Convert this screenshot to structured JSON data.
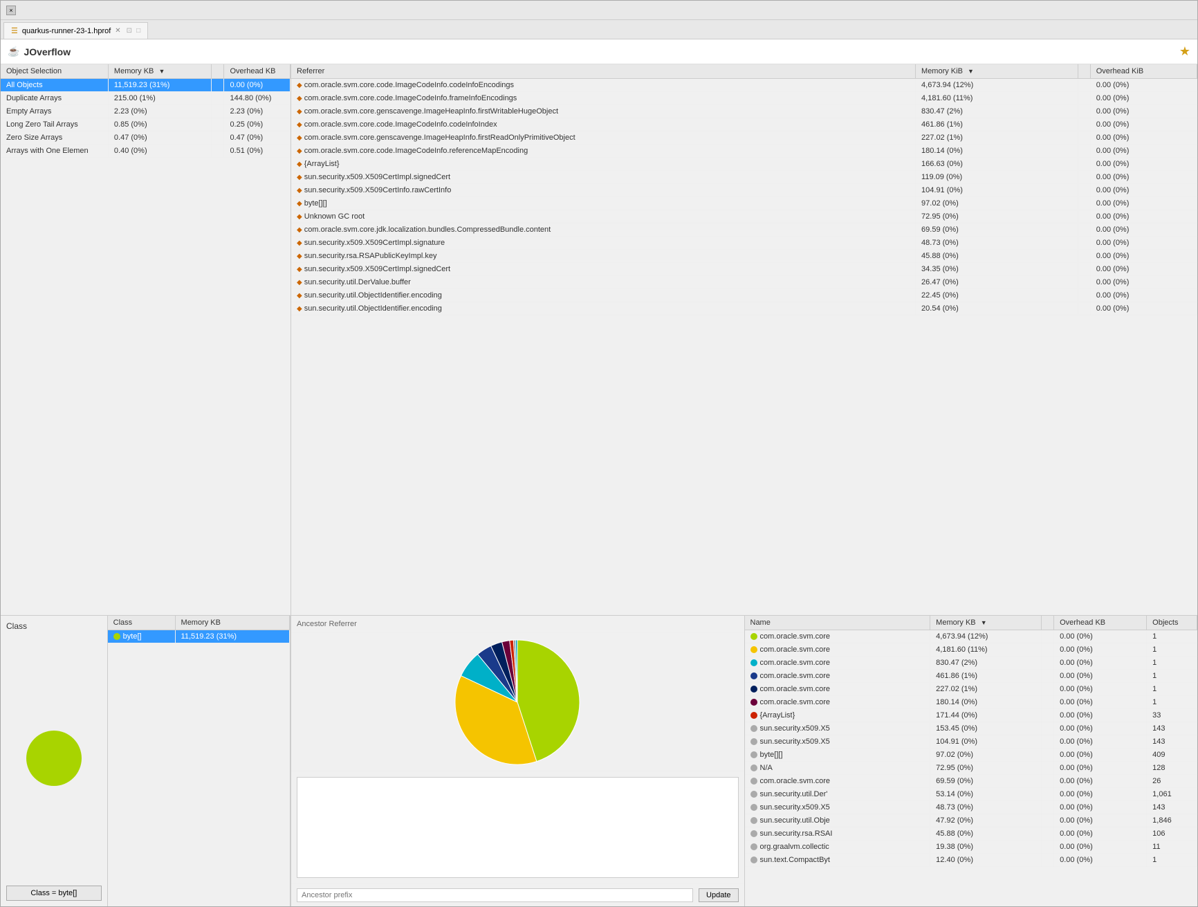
{
  "window": {
    "title": "quarkus-runner-23-1.hprof",
    "close_label": "×",
    "tab_label": "quarkus-runner-23-1.hprof",
    "app_title": "JOverflow",
    "gold_icon": "★"
  },
  "left_top": {
    "columns": [
      "Object Selection",
      "Memory KB",
      "",
      "Overhead KB"
    ],
    "sort_col": "Memory KB",
    "rows": [
      {
        "name": "All Objects",
        "memory": "11,519.23 (31%)",
        "overhead": "0.00 (0%)",
        "selected": true
      },
      {
        "name": "Duplicate Arrays",
        "memory": "215.00 (1%)",
        "overhead": "144.80 (0%)",
        "selected": false
      },
      {
        "name": "Empty Arrays",
        "memory": "2.23 (0%)",
        "overhead": "2.23 (0%)",
        "selected": false
      },
      {
        "name": "Long Zero Tail Arrays",
        "memory": "0.85 (0%)",
        "overhead": "0.25 (0%)",
        "selected": false
      },
      {
        "name": "Zero Size Arrays",
        "memory": "0.47 (0%)",
        "overhead": "0.47 (0%)",
        "selected": false
      },
      {
        "name": "Arrays with One Elemen",
        "memory": "0.40 (0%)",
        "overhead": "0.51 (0%)",
        "selected": false
      }
    ]
  },
  "right_top": {
    "columns": [
      "Referrer",
      "Memory KiB",
      "",
      "Overhead KiB"
    ],
    "rows": [
      {
        "name": "com.oracle.svm.core.code.ImageCodeInfo.codeInfoEncodings",
        "memory": "4,673.94 (12%)",
        "overhead": "0.00 (0%)"
      },
      {
        "name": "com.oracle.svm.core.code.ImageCodeInfo.frameInfoEncodings",
        "memory": "4,181.60 (11%)",
        "overhead": "0.00 (0%)"
      },
      {
        "name": "com.oracle.svm.core.genscavenge.ImageHeapInfo.firstWritableHugeObject",
        "memory": "830.47 (2%)",
        "overhead": "0.00 (0%)"
      },
      {
        "name": "com.oracle.svm.core.code.ImageCodeInfo.codeInfoIndex",
        "memory": "461.86 (1%)",
        "overhead": "0.00 (0%)"
      },
      {
        "name": "com.oracle.svm.core.genscavenge.ImageHeapInfo.firstReadOnlyPrimitiveObject",
        "memory": "227.02 (1%)",
        "overhead": "0.00 (0%)"
      },
      {
        "name": "com.oracle.svm.core.code.ImageCodeInfo.referenceMapEncoding",
        "memory": "180.14 (0%)",
        "overhead": "0.00 (0%)"
      },
      {
        "name": "{ArrayList}",
        "memory": "166.63 (0%)",
        "overhead": "0.00 (0%)"
      },
      {
        "name": "sun.security.x509.X509CertImpl.signedCert",
        "memory": "119.09 (0%)",
        "overhead": "0.00 (0%)"
      },
      {
        "name": "sun.security.x509.X509CertInfo.rawCertInfo",
        "memory": "104.91 (0%)",
        "overhead": "0.00 (0%)"
      },
      {
        "name": "byte[][]",
        "memory": "97.02 (0%)",
        "overhead": "0.00 (0%)"
      },
      {
        "name": "Unknown GC root",
        "memory": "72.95 (0%)",
        "overhead": "0.00 (0%)"
      },
      {
        "name": "com.oracle.svm.core.jdk.localization.bundles.CompressedBundle.content",
        "memory": "69.59 (0%)",
        "overhead": "0.00 (0%)"
      },
      {
        "name": "sun.security.x509.X509CertImpl.signature",
        "memory": "48.73 (0%)",
        "overhead": "0.00 (0%)"
      },
      {
        "name": "sun.security.rsa.RSAPublicKeyImpl.key",
        "memory": "45.88 (0%)",
        "overhead": "0.00 (0%)"
      },
      {
        "name": "sun.security.x509.X509CertImpl.signedCert",
        "memory": "34.35 (0%)",
        "overhead": "0.00 (0%)"
      },
      {
        "name": "sun.security.util.DerValue.buffer",
        "memory": "26.47 (0%)",
        "overhead": "0.00 (0%)"
      },
      {
        "name": "sun.security.util.ObjectIdentifier.encoding",
        "memory": "22.45 (0%)",
        "overhead": "0.00 (0%)"
      },
      {
        "name": "sun.security.util.ObjectIdentifier.encoding",
        "memory": "20.54 (0%)",
        "overhead": "0.00 (0%)"
      }
    ]
  },
  "bottom_left": {
    "class_label": "Class",
    "filter_btn_label": "Class = byte[]",
    "class_table_columns": [
      "Class",
      "Memory KB"
    ],
    "class_table_rows": [
      {
        "dot_color": "#a8d400",
        "name": "byte[]",
        "memory": "11,519.23 (31%)",
        "selected": true
      }
    ],
    "pie_color": "#a8d400"
  },
  "ancestor_referrer": {
    "title": "Ancestor Referrer",
    "input_placeholder": "Ancestor prefix",
    "update_btn_label": "Update",
    "pie_segments": [
      {
        "color": "#a8d400",
        "value": 45
      },
      {
        "color": "#f5c400",
        "value": 37
      },
      {
        "color": "#00b0c8",
        "value": 7
      },
      {
        "color": "#1a3a8a",
        "value": 4
      },
      {
        "color": "#001f5c",
        "value": 3
      },
      {
        "color": "#6b003a",
        "value": 2
      },
      {
        "color": "#cc2200",
        "value": 1
      },
      {
        "color": "#888",
        "value": 0.5
      },
      {
        "color": "#00a0c0",
        "value": 0.5
      }
    ]
  },
  "bottom_right": {
    "columns": [
      "Name",
      "Memory KB",
      "",
      "Overhead KB",
      "Objects"
    ],
    "rows": [
      {
        "dot_color": "#a8d400",
        "name": "com.oracle.svm.core",
        "memory": "4,673.94 (12%)",
        "overhead": "0.00 (0%)",
        "objects": "1"
      },
      {
        "dot_color": "#f5c400",
        "name": "com.oracle.svm.core",
        "memory": "4,181.60 (11%)",
        "overhead": "0.00 (0%)",
        "objects": "1"
      },
      {
        "dot_color": "#00b0c8",
        "name": "com.oracle.svm.core",
        "memory": "830.47 (2%)",
        "overhead": "0.00 (0%)",
        "objects": "1"
      },
      {
        "dot_color": "#1a3a8a",
        "name": "com.oracle.svm.core",
        "memory": "461.86 (1%)",
        "overhead": "0.00 (0%)",
        "objects": "1"
      },
      {
        "dot_color": "#001f5c",
        "name": "com.oracle.svm.core",
        "memory": "227.02 (1%)",
        "overhead": "0.00 (0%)",
        "objects": "1"
      },
      {
        "dot_color": "#6b003a",
        "name": "com.oracle.svm.core",
        "memory": "180.14 (0%)",
        "overhead": "0.00 (0%)",
        "objects": "1"
      },
      {
        "dot_color": "#cc2200",
        "name": "{ArrayList}",
        "memory": "171.44 (0%)",
        "overhead": "0.00 (0%)",
        "objects": "33"
      },
      {
        "dot_color": "#aaaaaa",
        "name": "sun.security.x509.X5",
        "memory": "153.45 (0%)",
        "overhead": "0.00 (0%)",
        "objects": "143"
      },
      {
        "dot_color": "#aaaaaa",
        "name": "sun.security.x509.X5",
        "memory": "104.91 (0%)",
        "overhead": "0.00 (0%)",
        "objects": "143"
      },
      {
        "dot_color": "#aaaaaa",
        "name": "byte[][]",
        "memory": "97.02 (0%)",
        "overhead": "0.00 (0%)",
        "objects": "409"
      },
      {
        "dot_color": "#aaaaaa",
        "name": "N/A",
        "memory": "72.95 (0%)",
        "overhead": "0.00 (0%)",
        "objects": "128"
      },
      {
        "dot_color": "#aaaaaa",
        "name": "com.oracle.svm.core",
        "memory": "69.59 (0%)",
        "overhead": "0.00 (0%)",
        "objects": "26"
      },
      {
        "dot_color": "#aaaaaa",
        "name": "sun.security.util.Der'",
        "memory": "53.14 (0%)",
        "overhead": "0.00 (0%)",
        "objects": "1,061"
      },
      {
        "dot_color": "#aaaaaa",
        "name": "sun.security.x509.X5",
        "memory": "48.73 (0%)",
        "overhead": "0.00 (0%)",
        "objects": "143"
      },
      {
        "dot_color": "#aaaaaa",
        "name": "sun.security.util.Obje",
        "memory": "47.92 (0%)",
        "overhead": "0.00 (0%)",
        "objects": "1,846"
      },
      {
        "dot_color": "#aaaaaa",
        "name": "sun.security.rsa.RSAI",
        "memory": "45.88 (0%)",
        "overhead": "0.00 (0%)",
        "objects": "106"
      },
      {
        "dot_color": "#aaaaaa",
        "name": "org.graalvm.collectic",
        "memory": "19.38 (0%)",
        "overhead": "0.00 (0%)",
        "objects": "11"
      },
      {
        "dot_color": "#aaaaaa",
        "name": "sun.text.CompactByt",
        "memory": "12.40 (0%)",
        "overhead": "0.00 (0%)",
        "objects": "1"
      }
    ]
  }
}
